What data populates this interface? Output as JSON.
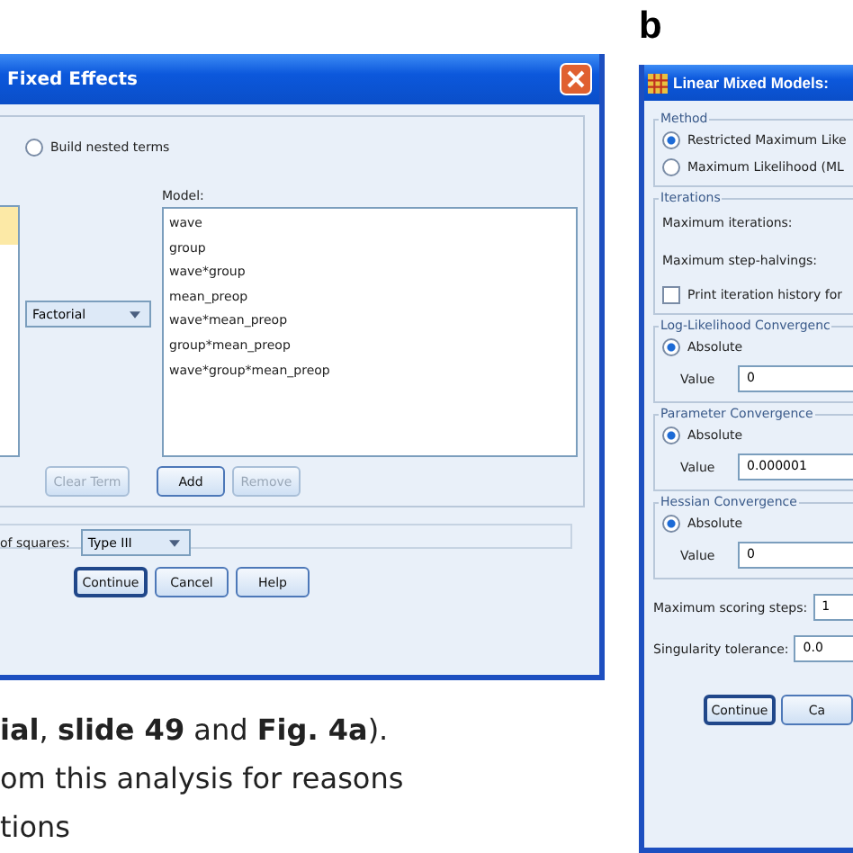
{
  "figure_a": {
    "window": {
      "title": "Fixed Effects"
    },
    "build_nested_terms": {
      "label": "Build nested terms",
      "selected": false
    },
    "term_type": {
      "value": "Factorial"
    },
    "model": {
      "label": "Model:",
      "items": [
        "wave",
        "group",
        "wave*group",
        "mean_preop",
        "wave*mean_preop",
        "group*mean_preop",
        "wave*group*mean_preop"
      ]
    },
    "term_buttons": [
      {
        "label": "Clear Term",
        "disabled": true
      },
      {
        "label": "Add",
        "disabled": false
      },
      {
        "label": "Remove",
        "disabled": true
      }
    ],
    "sum_of_squares": {
      "label": "of squares:",
      "value": "Type III"
    },
    "dialog_buttons": [
      {
        "label": "Continue",
        "default": true
      },
      {
        "label": "Cancel",
        "default": false
      },
      {
        "label": "Help",
        "default": false
      }
    ]
  },
  "caption_lines": [
    "**ial**, **slide 49** and **Fig. 4a**).",
    "om this analysis for reasons",
    "tions"
  ],
  "figure_b": {
    "panel_label": "b",
    "window": {
      "title": "Linear Mixed Models:"
    },
    "method": {
      "title": "Method",
      "options": [
        {
          "label": "Restricted Maximum Like",
          "selected": true
        },
        {
          "label": "Maximum Likelihood (ML",
          "selected": false
        }
      ]
    },
    "iterations": {
      "title": "Iterations",
      "fields": [
        "Maximum iterations:",
        "Maximum step-halvings:"
      ],
      "print_history": {
        "label": "Print iteration history for",
        "checked": false
      }
    },
    "convergence": [
      {
        "title": "Log-Likelihood Convergenc",
        "option": {
          "label": "Absolute",
          "selected": true
        },
        "value_label": "Value",
        "value": "0"
      },
      {
        "title": "Parameter Convergence",
        "option": {
          "label": "Absolute",
          "selected": true
        },
        "value_label": "Value",
        "value": "0.000001"
      },
      {
        "title": "Hessian Convergence",
        "option": {
          "label": "Absolute",
          "selected": true
        },
        "value_label": "Value",
        "value": "0"
      }
    ],
    "scoring_steps": {
      "label": "Maximum scoring steps:",
      "value": "1"
    },
    "singularity": {
      "label": "Singularity tolerance:",
      "value": "0.0"
    },
    "dialog_buttons": [
      {
        "label": "Continue",
        "default": true
      },
      {
        "label": "Ca",
        "default": false
      }
    ]
  }
}
